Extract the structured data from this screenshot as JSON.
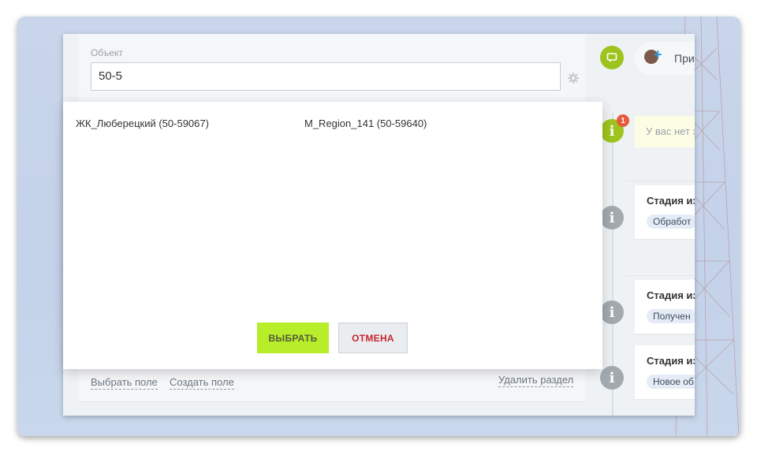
{
  "form": {
    "field_label": "Объект",
    "field_value": "50-5",
    "link_select_field": "Выбрать поле",
    "link_create_field": "Создать поле",
    "link_delete_section": "Удалить раздел"
  },
  "popup": {
    "items": [
      "ЖК_Люберецкий (50-59067)",
      "M_Region_141 (50-59640)"
    ],
    "select_label": "ВЫБРАТЬ",
    "cancel_label": "ОТМЕНА"
  },
  "timeline": {
    "invite_label": "При",
    "notification_count": "1",
    "warning_text": "У вас нет з",
    "events": [
      {
        "title": "Стадия из",
        "chip": "Обработ"
      },
      {
        "title": "Стадия из",
        "chip": "Получен"
      },
      {
        "title": "Стадия из",
        "chip": "Новое об"
      }
    ]
  },
  "colors": {
    "accent_green": "#b8ed29",
    "cancel_red": "#c8242c",
    "timeline_green": "#9dc41e",
    "badge_red": "#e55b3c"
  }
}
